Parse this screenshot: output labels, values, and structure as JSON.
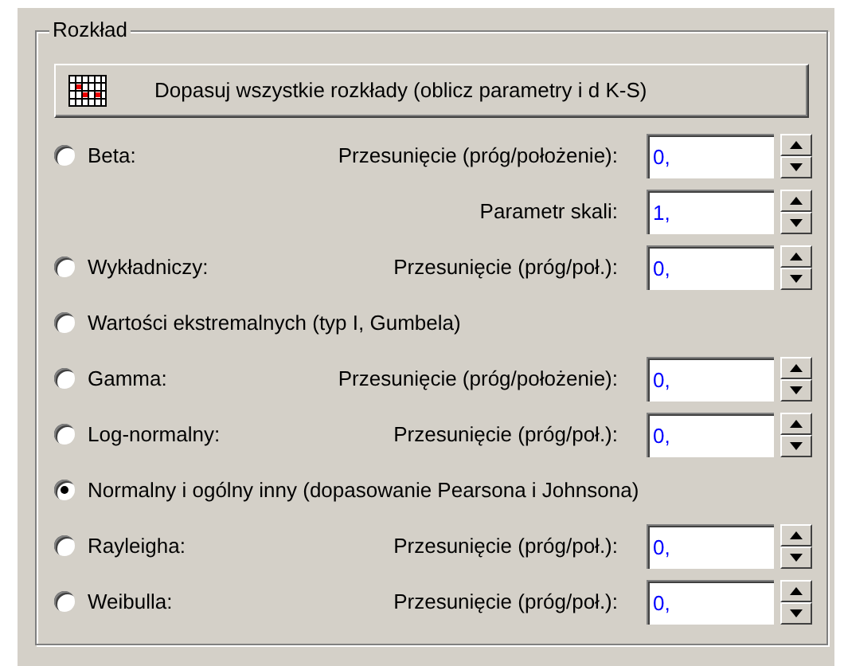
{
  "group": {
    "title": "Rozkład"
  },
  "fit_button": {
    "label": "Dopasuj wszystkie rozkłady (oblicz parametry i d K-S)"
  },
  "options": [
    {
      "kind": "param",
      "label": "Beta:",
      "selected": false,
      "fields": [
        {
          "label": "Przesunięcie (próg/położenie):",
          "value": "0,"
        },
        {
          "label": "Parametr skali:",
          "value": "1,"
        }
      ]
    },
    {
      "kind": "param",
      "label": "Wykładniczy:",
      "selected": false,
      "fields": [
        {
          "label": "Przesunięcie (próg/poł.):",
          "value": "0,"
        }
      ]
    },
    {
      "kind": "plain",
      "label": "Wartości ekstremalnych (typ I, Gumbela)",
      "selected": false
    },
    {
      "kind": "param",
      "label": "Gamma:",
      "selected": false,
      "fields": [
        {
          "label": "Przesunięcie (próg/położenie):",
          "value": "0,"
        }
      ]
    },
    {
      "kind": "param",
      "label": "Log-normalny:",
      "selected": false,
      "fields": [
        {
          "label": "Przesunięcie (próg/poł.):",
          "value": "0,"
        }
      ]
    },
    {
      "kind": "plain",
      "label": "Normalny i ogólny inny (dopasowanie Pearsona i Johnsona)",
      "selected": true
    },
    {
      "kind": "param",
      "label": "Rayleigha:",
      "selected": false,
      "fields": [
        {
          "label": "Przesunięcie (próg/poł.):",
          "value": "0,"
        }
      ]
    },
    {
      "kind": "param",
      "label": "Weibulla:",
      "selected": false,
      "fields": [
        {
          "label": "Przesunięcie (próg/poł.):",
          "value": "0,"
        }
      ]
    }
  ]
}
